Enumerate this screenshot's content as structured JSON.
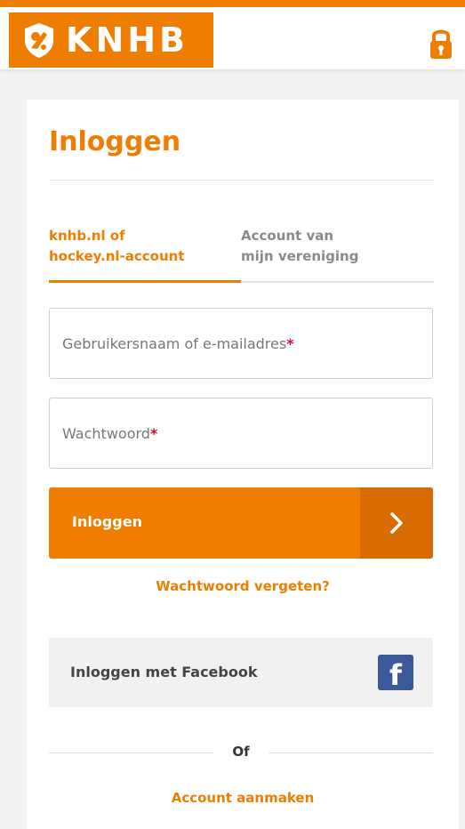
{
  "header": {
    "logo_text": "KNHB",
    "logo_icon": "hockey-shield-icon",
    "lock_icon": "lock-icon"
  },
  "login": {
    "title": "Inloggen",
    "tabs": [
      {
        "label_line1": "knhb.nl of",
        "label_line2": "hockey.nl-account",
        "active": true
      },
      {
        "label_line1": "Account van",
        "label_line2": "mijn vereniging",
        "active": false
      }
    ],
    "username_placeholder": "Gebruikersnaam of e-mailadres",
    "password_placeholder": "Wachtwoord",
    "required_marker": "*",
    "submit_label": "Inloggen",
    "submit_icon": "chevron-right-icon",
    "forgot_label": "Wachtwoord vergeten?",
    "facebook_label": "Inloggen met Facebook",
    "facebook_icon": "facebook-icon",
    "facebook_glyph": "f",
    "or_label": "Of",
    "create_account_label": "Account aanmaken"
  },
  "colors": {
    "brand_orange": "#ef7d00",
    "brand_orange_dark": "#d96c00",
    "required_red": "#c8102e",
    "facebook_blue": "#3b5998"
  }
}
